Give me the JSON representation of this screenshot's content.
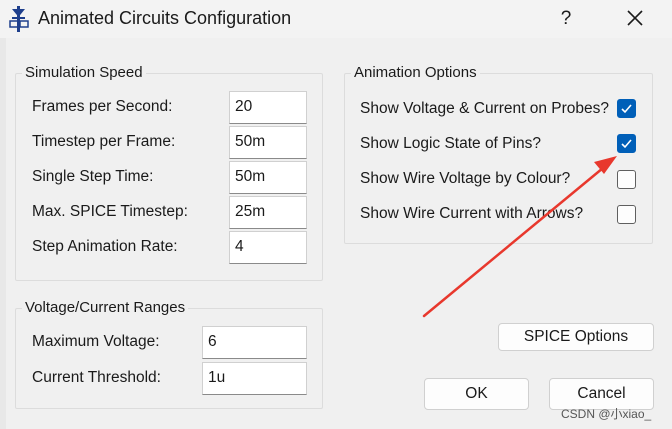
{
  "window": {
    "title": "Animated Circuits Configuration",
    "help_label": "?",
    "close_icon": "close-icon",
    "app_icon": "diode-circuit-icon"
  },
  "simulation_speed": {
    "title": "Simulation Speed",
    "fields": [
      {
        "label": "Frames per Second:",
        "value": "20"
      },
      {
        "label": "Timestep per Frame:",
        "value": "50m"
      },
      {
        "label": "Single Step Time:",
        "value": "50m"
      },
      {
        "label": "Max. SPICE Timestep:",
        "value": "25m"
      },
      {
        "label": "Step Animation Rate:",
        "value": "4"
      }
    ]
  },
  "ranges": {
    "title": "Voltage/Current Ranges",
    "fields": [
      {
        "label": "Maximum Voltage:",
        "value": "6"
      },
      {
        "label": "Current Threshold:",
        "value": "1u"
      }
    ]
  },
  "animation_options": {
    "title": "Animation Options",
    "options": [
      {
        "label": "Show Voltage & Current on Probes?",
        "checked": true
      },
      {
        "label": "Show Logic State of Pins?",
        "checked": true
      },
      {
        "label": "Show Wire Voltage by Colour?",
        "checked": false
      },
      {
        "label": "Show Wire Current with Arrows?",
        "checked": false
      }
    ]
  },
  "buttons": {
    "spice_options": "SPICE Options",
    "ok": "OK",
    "cancel": "Cancel"
  },
  "annotation": {
    "color": "#e8382d"
  },
  "accent_color": "#005fb8",
  "watermark": "CSDN @小xiao_"
}
